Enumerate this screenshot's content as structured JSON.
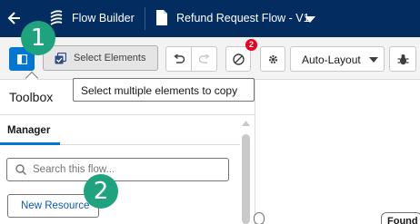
{
  "header": {
    "app_title": "Flow Builder",
    "flow_title": "Refund Request Flow - V1",
    "icons": [
      "back-arrow-icon",
      "flow-builder-logo-icon",
      "flow-file-icon",
      "chevron-down-icon"
    ]
  },
  "toolbar": {
    "select_elements_label": "Select Elements",
    "error_count": "2",
    "layout_select_value": "Auto-Layout",
    "icons": [
      "toggle-panel-icon",
      "select-elements-icon",
      "undo-icon",
      "redo-icon",
      "no-entry-icon",
      "gear-icon",
      "chevron-down-icon",
      "debug-icon"
    ]
  },
  "tooltip": {
    "text": "Select multiple elements to copy"
  },
  "toolbox": {
    "title": "Toolbox",
    "active_tab": "Manager",
    "search_placeholder": "Search this flow...",
    "new_resource_label": "New Resource"
  },
  "canvas": {
    "node_label": "Found r"
  },
  "markers": {
    "step_1": "1",
    "step_2": "2"
  },
  "colors": {
    "header_bg": "#032d60",
    "brand_blue": "#0176d3",
    "marker_green": "#1fa37f",
    "error_red": "#ea001e"
  }
}
